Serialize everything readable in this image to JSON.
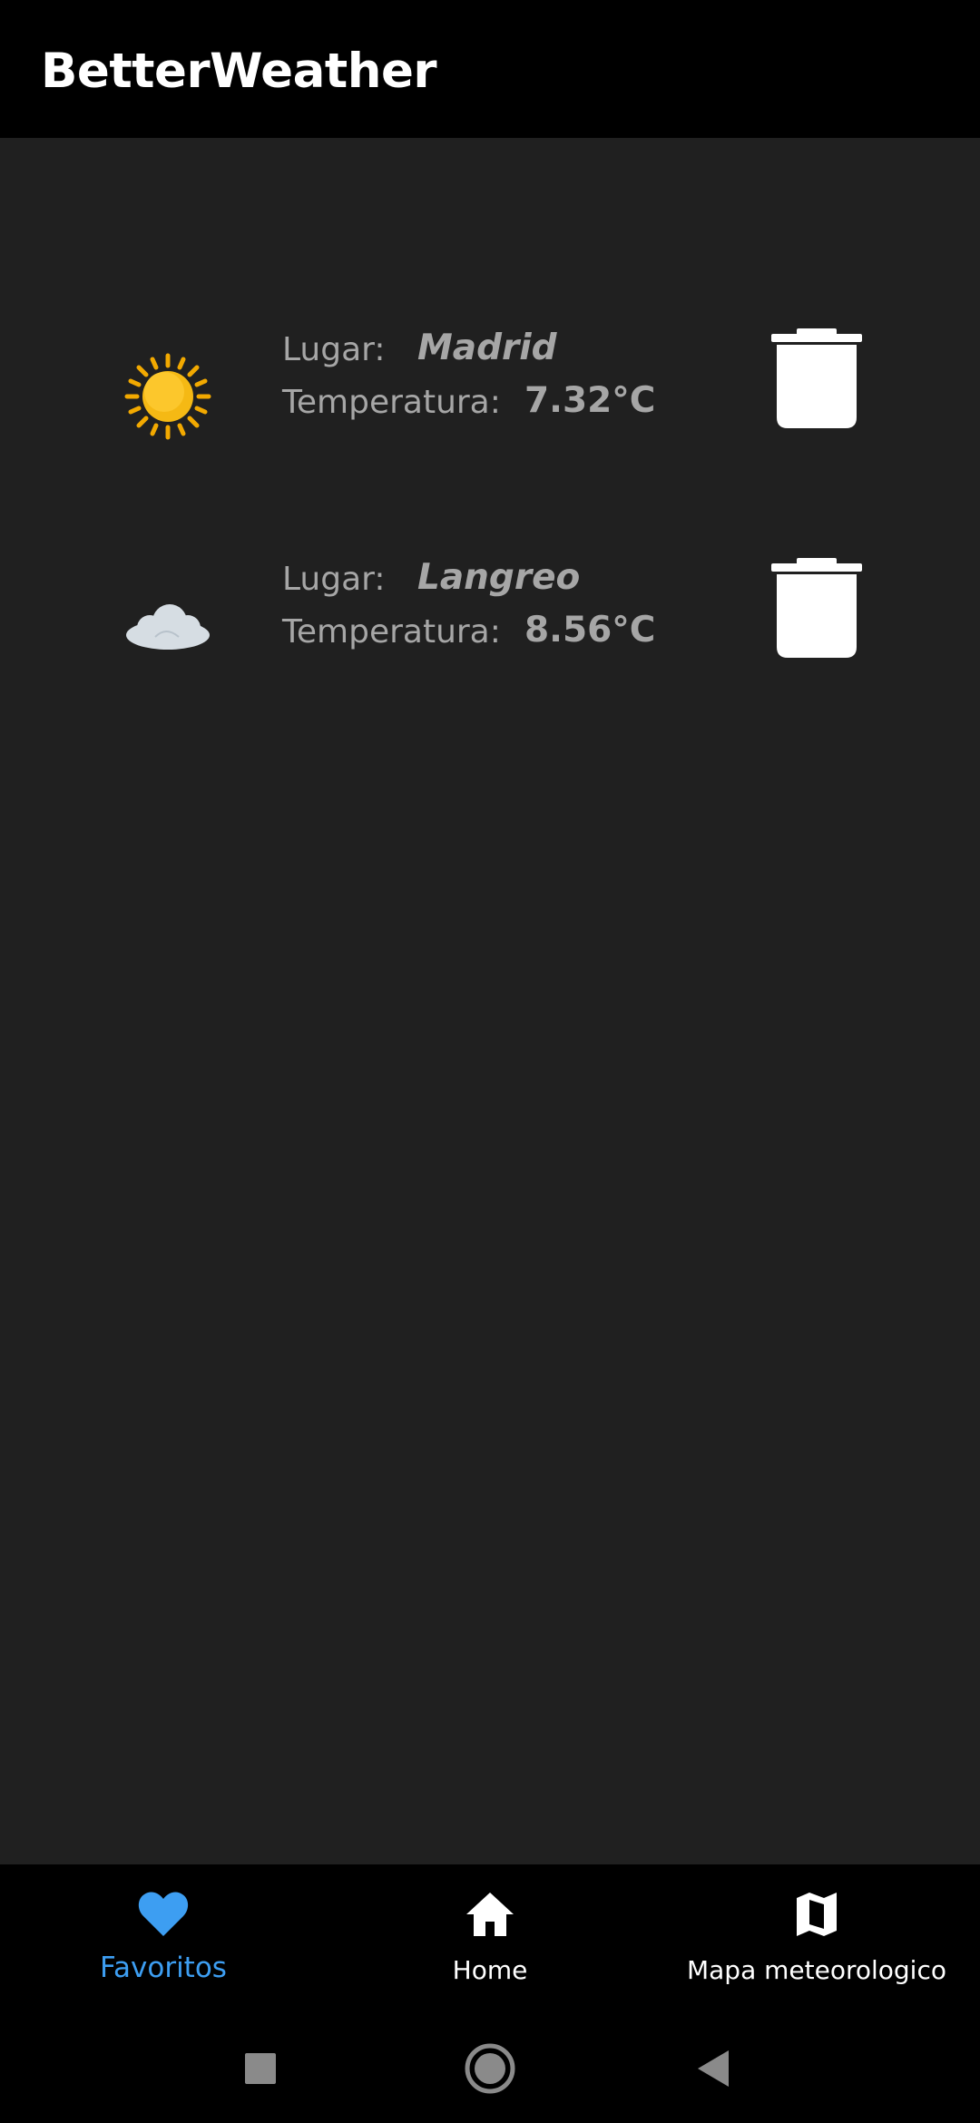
{
  "app_bar": {
    "title": "BetterWeather"
  },
  "favorites": [
    {
      "place_label": "Lugar:",
      "place": "Madrid",
      "temp_label": "Temperatura:",
      "temperature": "7.32°C",
      "icon": "sun-icon"
    },
    {
      "place_label": "Lugar:",
      "place": "Langreo",
      "temp_label": "Temperatura:",
      "temperature": "8.56°C",
      "icon": "cloud-icon"
    }
  ],
  "bottom_nav": {
    "items": [
      {
        "label": "Favoritos",
        "icon": "heart-icon",
        "active": true
      },
      {
        "label": "Home",
        "icon": "home-icon",
        "active": false
      },
      {
        "label": "Mapa meteorologico",
        "icon": "map-icon",
        "active": false
      }
    ]
  },
  "colors": {
    "app_bar_bg": "#000000",
    "content_bg": "#202020",
    "text_secondary": "#a6a6a6",
    "active_tab": "#3d9ef2",
    "sun": "#f5b914",
    "cloud": "#d6dde3"
  }
}
